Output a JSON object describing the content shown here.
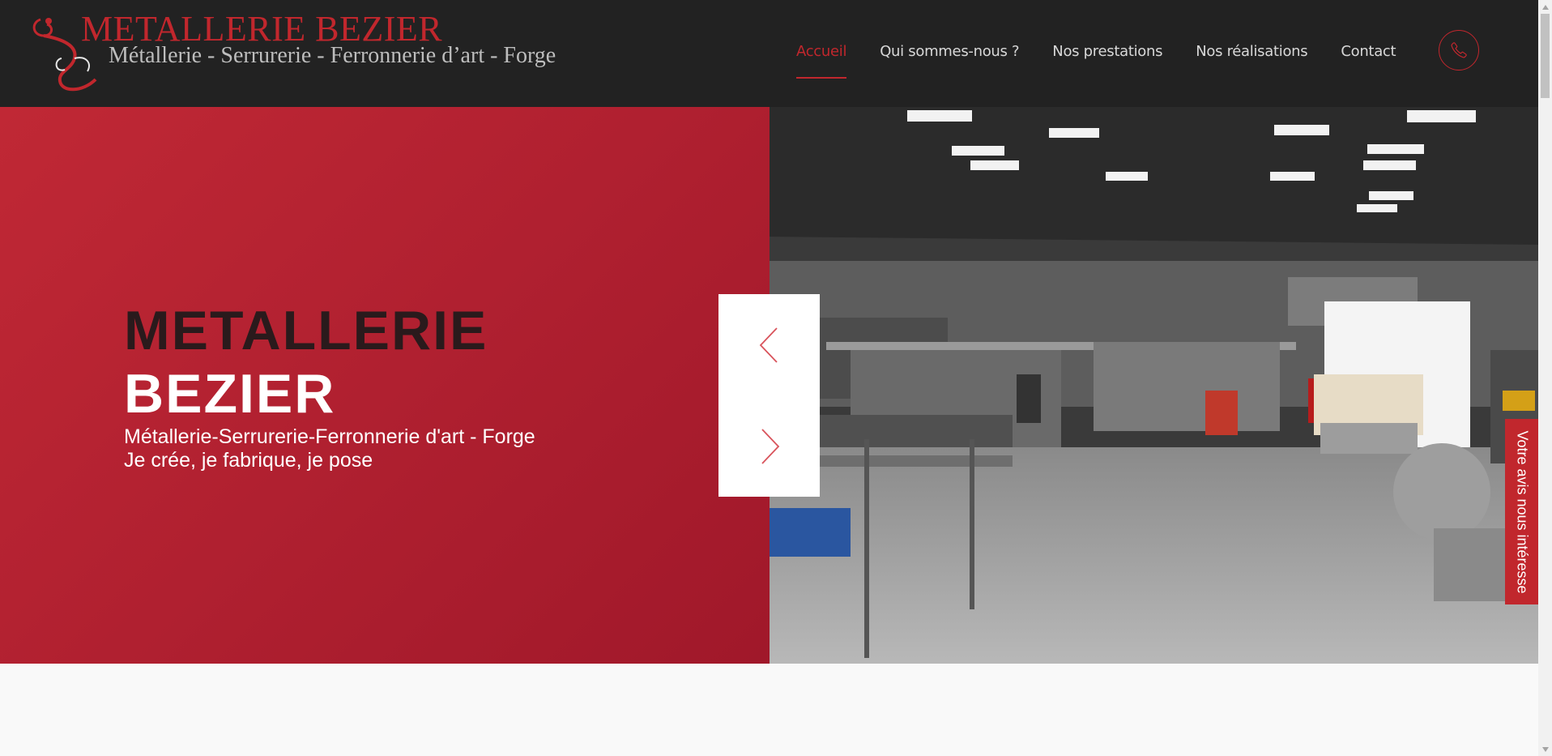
{
  "colors": {
    "accent": "#c1272d",
    "header_bg": "#222222",
    "hero_red": "#b02030"
  },
  "logo": {
    "title": "METALLERIE BEZIER",
    "subtitle": "Métallerie - Serrurerie - Ferronnerie d’art - Forge"
  },
  "nav": {
    "items": [
      {
        "label": "Accueil",
        "active": true
      },
      {
        "label": "Qui sommes-nous ?",
        "active": false
      },
      {
        "label": "Nos prestations",
        "active": false
      },
      {
        "label": "Nos réalisations",
        "active": false
      },
      {
        "label": "Contact",
        "active": false
      }
    ],
    "phone_icon": "phone-icon"
  },
  "hero": {
    "title_line1": "METALLERIE",
    "title_line2": "BEZIER",
    "subtitle_line1": "Métallerie-Serrurerie-Ferronnerie d'art - Forge",
    "subtitle_line2": "Je crée, je fabrique, je pose",
    "image": "workshop-photo"
  },
  "slider": {
    "prev_icon": "chevron-left-icon",
    "next_icon": "chevron-right-icon"
  },
  "feedback_tab": {
    "label": "Votre avis nous intéresse"
  }
}
